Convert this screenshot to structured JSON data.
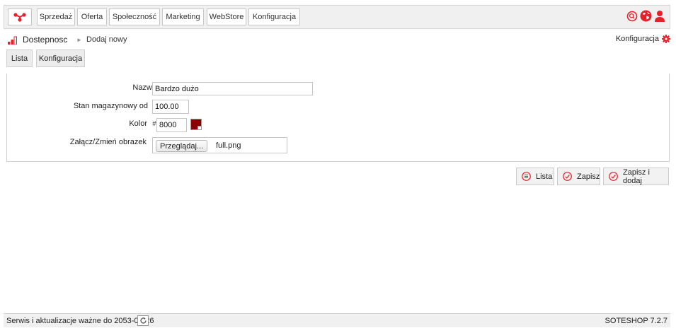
{
  "colors": {
    "brand": "#e8202a",
    "swatch": "#8b0000"
  },
  "topnav": {
    "logo_icon": "soteshop-logo-icon",
    "items": [
      "Sprzedaż",
      "Oferta",
      "Społeczność",
      "Marketing",
      "WebStore",
      "Konfiguracja"
    ],
    "icons": [
      "search-icon",
      "globe-icon",
      "user-icon"
    ]
  },
  "page": {
    "title": "Dostepnosc",
    "separator": "►",
    "subtitle": "Dodaj nowy",
    "config_link": "Konfiguracja"
  },
  "tabs": [
    "Lista",
    "Konfiguracja"
  ],
  "form": {
    "name_label": "Nazwa",
    "name_value": "Bardzo dużo",
    "stock_label": "Stan magazynowy od",
    "stock_value": "100.00",
    "color_label": "Kolor",
    "color_hash": "#",
    "color_value": "8000",
    "image_label": "Załącz/Zmień obrazek",
    "browse_label": "Przeglądaj...",
    "file_name": "full.png"
  },
  "actions": {
    "list_label": "Lista",
    "save_label": "Zapisz",
    "save_add_label": "Zapisz i dodaj"
  },
  "footer": {
    "service_text": "Serwis i aktualizacje ważne do 2053-08-26",
    "version": "SOTESHOP 7.2.7"
  }
}
